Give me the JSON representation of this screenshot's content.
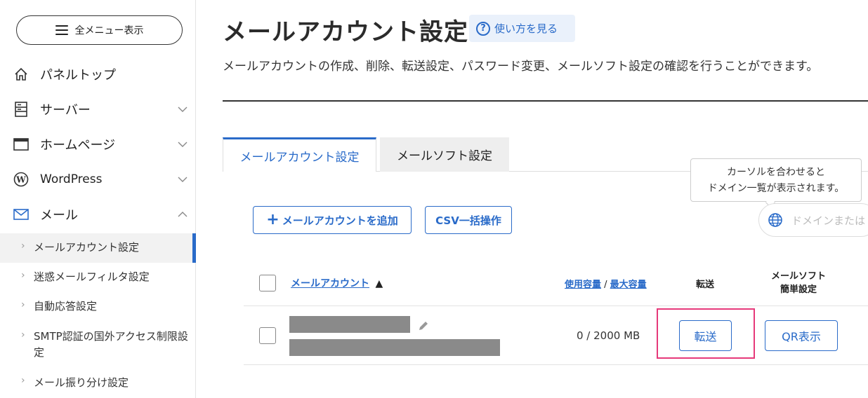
{
  "sidebar": {
    "menu_button": "全メニュー表示",
    "nav": [
      {
        "label": "パネルトップ",
        "icon": "home-icon"
      },
      {
        "label": "サーバー",
        "icon": "server-icon"
      },
      {
        "label": "ホームページ",
        "icon": "browser-window-icon"
      },
      {
        "label": "WordPress",
        "icon": "wordpress-icon"
      },
      {
        "label": "メール",
        "icon": "mail-icon"
      }
    ],
    "mail_sub": [
      {
        "label": "メールアカウント設定",
        "active": true
      },
      {
        "label": "迷惑メールフィルタ設定"
      },
      {
        "label": "自動応答設定"
      },
      {
        "label": "SMTP認証の国外アクセス制限設定"
      },
      {
        "label": "メール振り分け設定"
      }
    ]
  },
  "header": {
    "title": "メールアカウント設定",
    "howto": "使い方を見る",
    "description": "メールアカウントの作成、削除、転送設定、パスワード変更、メールソフト設定の確認を行うことができます。"
  },
  "tabs": [
    {
      "label": "メールアカウント設定",
      "active": true
    },
    {
      "label": "メールソフト設定",
      "active": false
    }
  ],
  "tooltip": {
    "line1": "カーソルを合わせると",
    "line2": "ドメイン一覧が表示されます。"
  },
  "actions": {
    "add_account": "メールアカウントを追加",
    "csv": "CSV一括操作",
    "domain_search_placeholder": "ドメインまたは"
  },
  "table": {
    "headers": {
      "account": "メールアカウント",
      "sort_indicator": "▲",
      "usage": "使用容量",
      "usage_sep": " / ",
      "max": "最大容量",
      "forward": "転送",
      "mailsoft_line1": "メールソフト",
      "mailsoft_line2": "簡単設定"
    },
    "rows": [
      {
        "usage": "0 / 2000 MB",
        "forward_button": "転送",
        "qr_button": "QR表示"
      }
    ]
  },
  "colors": {
    "accent": "#2a6bc9",
    "highlight": "#e6397a"
  }
}
